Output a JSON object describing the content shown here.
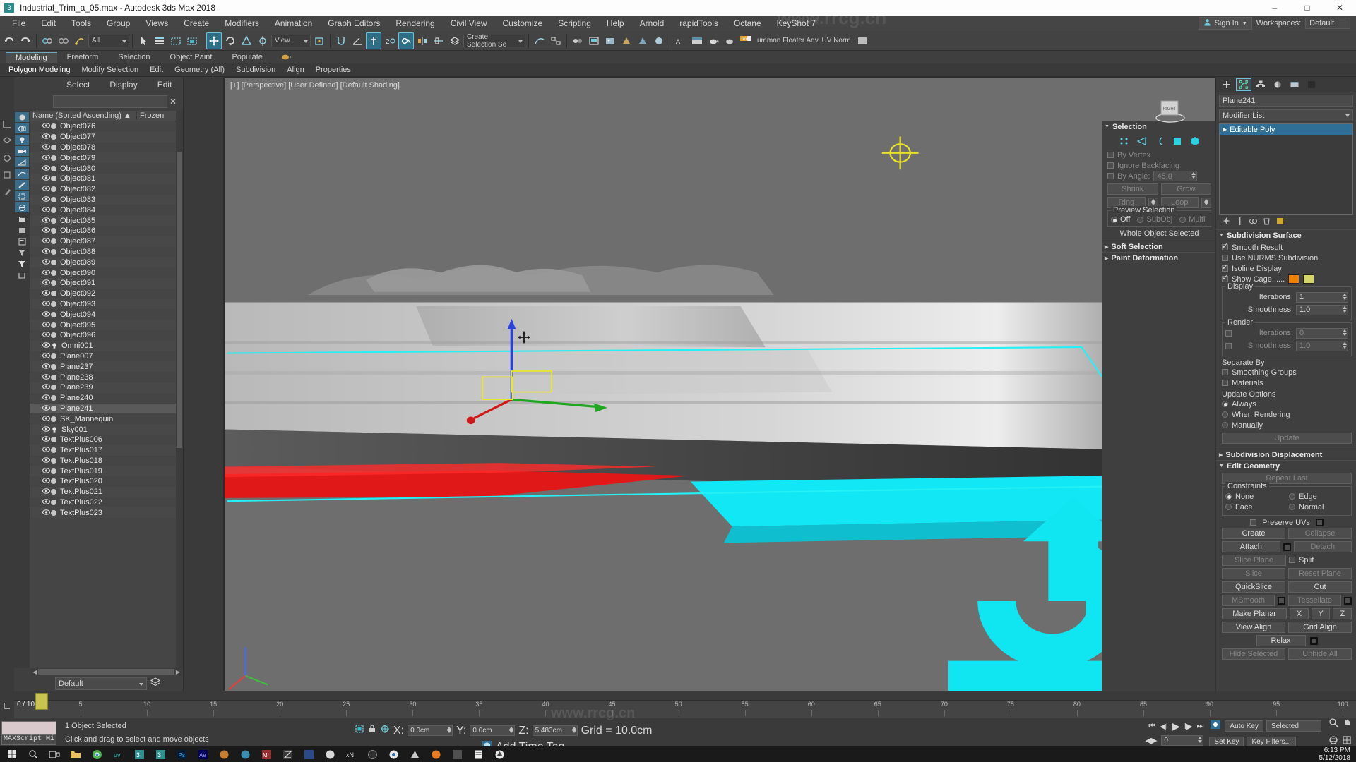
{
  "titlebar": {
    "title": "Industrial_Trim_a_05.max - Autodesk 3ds Max 2018",
    "app_icon": "3dsmax-icon",
    "minimize": "–",
    "maximize": "□",
    "close": "✕"
  },
  "menubar": {
    "items": [
      "File",
      "Edit",
      "Tools",
      "Group",
      "Views",
      "Create",
      "Modifiers",
      "Animation",
      "Graph Editors",
      "Rendering",
      "Civil View",
      "Customize",
      "Scripting",
      "Help",
      "Arnold",
      "rapidTools",
      "Octane",
      "KeyShot 7"
    ],
    "signin": "Sign In",
    "workspaces_label": "Workspaces:",
    "workspace_value": "Default"
  },
  "toolbar": {
    "selection_filter": "All",
    "view_coord": "View",
    "named_selection": "Create Selection Se",
    "right_label": "ummon Floater Adv.  UV Norm"
  },
  "ribbon": {
    "tabs": [
      "Modeling",
      "Freeform",
      "Selection",
      "Object Paint",
      "Populate"
    ],
    "active_tab": "Modeling",
    "buttons": [
      "Polygon Modeling",
      "Modify Selection",
      "Edit",
      "Geometry (All)",
      "Subdivision",
      "Align",
      "Properties"
    ],
    "active_button": "Polygon Modeling"
  },
  "explorer": {
    "menu": [
      "Select",
      "Display",
      "Edit"
    ],
    "search_value": "",
    "clear_icon": "close-icon",
    "columns": {
      "name": "Name (Sorted Ascending)",
      "sort_arrow": "▲",
      "frozen": "Frozen"
    },
    "filter_icons": [
      "sphere-filter-icon",
      "geometry-filter-icon",
      "light-filter-icon",
      "camera-filter-icon",
      "helper-filter-icon",
      "spacewarp-filter-icon",
      "bone-filter-icon",
      "group-filter-icon",
      "xref-filter-icon",
      "list-icon",
      "layer-icon",
      "sheet-icon",
      "filter-off-icon",
      "filter-icon",
      "container-icon"
    ],
    "rows": [
      {
        "name": "Object076",
        "type": "geometry"
      },
      {
        "name": "Object077",
        "type": "geometry"
      },
      {
        "name": "Object078",
        "type": "geometry"
      },
      {
        "name": "Object079",
        "type": "geometry"
      },
      {
        "name": "Object080",
        "type": "geometry"
      },
      {
        "name": "Object081",
        "type": "geometry"
      },
      {
        "name": "Object082",
        "type": "geometry"
      },
      {
        "name": "Object083",
        "type": "geometry"
      },
      {
        "name": "Object084",
        "type": "geometry"
      },
      {
        "name": "Object085",
        "type": "geometry"
      },
      {
        "name": "Object086",
        "type": "geometry"
      },
      {
        "name": "Object087",
        "type": "geometry"
      },
      {
        "name": "Object088",
        "type": "geometry"
      },
      {
        "name": "Object089",
        "type": "geometry"
      },
      {
        "name": "Object090",
        "type": "geometry"
      },
      {
        "name": "Object091",
        "type": "geometry"
      },
      {
        "name": "Object092",
        "type": "geometry"
      },
      {
        "name": "Object093",
        "type": "geometry"
      },
      {
        "name": "Object094",
        "type": "geometry"
      },
      {
        "name": "Object095",
        "type": "geometry"
      },
      {
        "name": "Object096",
        "type": "geometry"
      },
      {
        "name": "Omni001",
        "type": "light"
      },
      {
        "name": "Plane007",
        "type": "geometry"
      },
      {
        "name": "Plane237",
        "type": "geometry"
      },
      {
        "name": "Plane238",
        "type": "geometry"
      },
      {
        "name": "Plane239",
        "type": "geometry"
      },
      {
        "name": "Plane240",
        "type": "geometry"
      },
      {
        "name": "Plane241",
        "type": "geometry",
        "selected": true
      },
      {
        "name": "SK_Mannequin",
        "type": "geometry"
      },
      {
        "name": "Sky001",
        "type": "light"
      },
      {
        "name": "TextPlus006",
        "type": "geometry"
      },
      {
        "name": "TextPlus017",
        "type": "geometry"
      },
      {
        "name": "TextPlus018",
        "type": "geometry"
      },
      {
        "name": "TextPlus019",
        "type": "geometry"
      },
      {
        "name": "TextPlus020",
        "type": "geometry"
      },
      {
        "name": "TextPlus021",
        "type": "geometry"
      },
      {
        "name": "TextPlus022",
        "type": "geometry"
      },
      {
        "name": "TextPlus023",
        "type": "geometry"
      }
    ],
    "footer_layer": "Default"
  },
  "viewport": {
    "label": "[+] [Perspective] [User Defined] [Default Shading]",
    "viewcube_face": "RIGHT",
    "cursor_icon": "move-cursor-icon"
  },
  "command_panel": {
    "tabs": [
      "create-tab",
      "modify-tab",
      "hierarchy-tab",
      "motion-tab",
      "display-tab",
      "utilities-tab"
    ],
    "active_tab": "modify-tab",
    "object_name": "Plane241",
    "modifier_list_label": "Modifier List",
    "stack": [
      {
        "label": "Editable Poly",
        "selected": true
      }
    ],
    "rollouts": {
      "subdivision_surface": {
        "title": "Subdivision Surface",
        "smooth_result": {
          "label": "Smooth Result",
          "checked": true
        },
        "use_nurms": {
          "label": "Use NURMS Subdivision",
          "checked": false
        },
        "isoline_display": {
          "label": "Isoline Display",
          "checked": true
        },
        "show_cage": {
          "label": "Show Cage......",
          "checked": true,
          "color1": "#f08000",
          "color2": "#d6d668"
        },
        "display_group": {
          "title": "Display",
          "iterations_label": "Iterations:",
          "iterations_value": "1",
          "smoothness_label": "Smoothness:",
          "smoothness_value": "1.0"
        },
        "render_group": {
          "title": "Render",
          "iterations_label": "Iterations:",
          "iterations_value": "0",
          "smoothness_label": "Smoothness:",
          "smoothness_value": "1.0"
        },
        "separate_by": {
          "title": "Separate By",
          "smoothing_groups": "Smoothing Groups",
          "materials": "Materials"
        },
        "update_options": {
          "title": "Update Options",
          "always": "Always",
          "when_rendering": "When Rendering",
          "manually": "Manually",
          "update_button": "Update",
          "selected": "Always"
        }
      },
      "subdivision_displacement": {
        "title": "Subdivision Displacement"
      },
      "selection": {
        "title": "Selection",
        "subobject_icons": [
          "vertex-icon",
          "edge-icon",
          "border-icon",
          "polygon-icon",
          "element-icon"
        ],
        "by_vertex": "By Vertex",
        "ignore_backfacing": "Ignore Backfacing",
        "by_angle": "By Angle:",
        "by_angle_value": "45.0",
        "shrink": "Shrink",
        "grow": "Grow",
        "ring": "Ring",
        "loop": "Loop",
        "preview_selection": "Preview Selection",
        "off": "Off",
        "subobj": "SubObj",
        "multi": "Multi",
        "status": "Whole Object Selected"
      },
      "soft_selection": {
        "title": "Soft Selection"
      },
      "paint_deformation": {
        "title": "Paint Deformation"
      },
      "edit_geometry": {
        "title": "Edit Geometry",
        "repeat_last": "Repeat Last",
        "constraints": {
          "title": "Constraints",
          "none": "None",
          "edge": "Edge",
          "face": "Face",
          "normal": "Normal",
          "selected": "None"
        },
        "preserve_uvs": "Preserve UVs",
        "create": "Create",
        "collapse": "Collapse",
        "attach": "Attach",
        "detach": "Detach",
        "slice_plane": "Slice Plane",
        "split": "Split",
        "slice": "Slice",
        "reset_plane": "Reset Plane",
        "quickslice": "QuickSlice",
        "cut": "Cut",
        "msmooth": "MSmooth",
        "tessellate": "Tessellate",
        "make_planar": "Make Planar",
        "x": "X",
        "y": "Y",
        "z": "Z",
        "view_align": "View Align",
        "grid_align": "Grid Align",
        "relax": "Relax",
        "hide_selected": "Hide Selected",
        "unhide_all": "Unhide All"
      }
    }
  },
  "timeline": {
    "ticks": [
      "5",
      "10",
      "15",
      "20",
      "25",
      "30",
      "35",
      "40",
      "45",
      "50",
      "55",
      "60",
      "65",
      "70",
      "75",
      "80",
      "85",
      "90",
      "95",
      "100"
    ],
    "current_frame": "0 / 100",
    "frame_field": "0"
  },
  "statusbar": {
    "maxscript_label": "MAXScript Mi",
    "selection_status": "1 Object Selected",
    "prompt": "Click and drag to select and move objects",
    "lock_icon": "lock-icon",
    "coord_icon": "absolute-mode-icon",
    "x_label": "X:",
    "x_value": "0.0cm",
    "y_label": "Y:",
    "y_value": "0.0cm",
    "z_label": "Z:",
    "z_value": "5.483cm",
    "grid": "Grid = 10.0cm",
    "add_time_tag": "Add Time Tag",
    "auto_key": "Auto Key",
    "set_key": "Set Key",
    "key_filters": "Key Filters...",
    "selected_combo": "Selected",
    "key_frame_value": "0"
  },
  "taskbar": {
    "clock_time": "6:13 PM",
    "clock_date": "5/12/2018",
    "items": [
      "start-icon",
      "search-icon",
      "taskview-icon",
      "folder-icon",
      "chrome-icon",
      "uv-icon",
      "max-icon-1",
      "max-icon-2",
      "photoshop-icon",
      "after-effects-icon",
      "substance-icon-1",
      "substance-icon-2",
      "marmoset-icon",
      "zbrush-icon",
      "app-icon-1",
      "app-icon-2",
      "xnormal-icon",
      "app-icon-3",
      "quixel-icon",
      "knald-icon",
      "firefox-icon",
      "app-icon-4",
      "notes-icon",
      "unity-icon"
    ]
  },
  "watermark": "www.rrcg.cn"
}
